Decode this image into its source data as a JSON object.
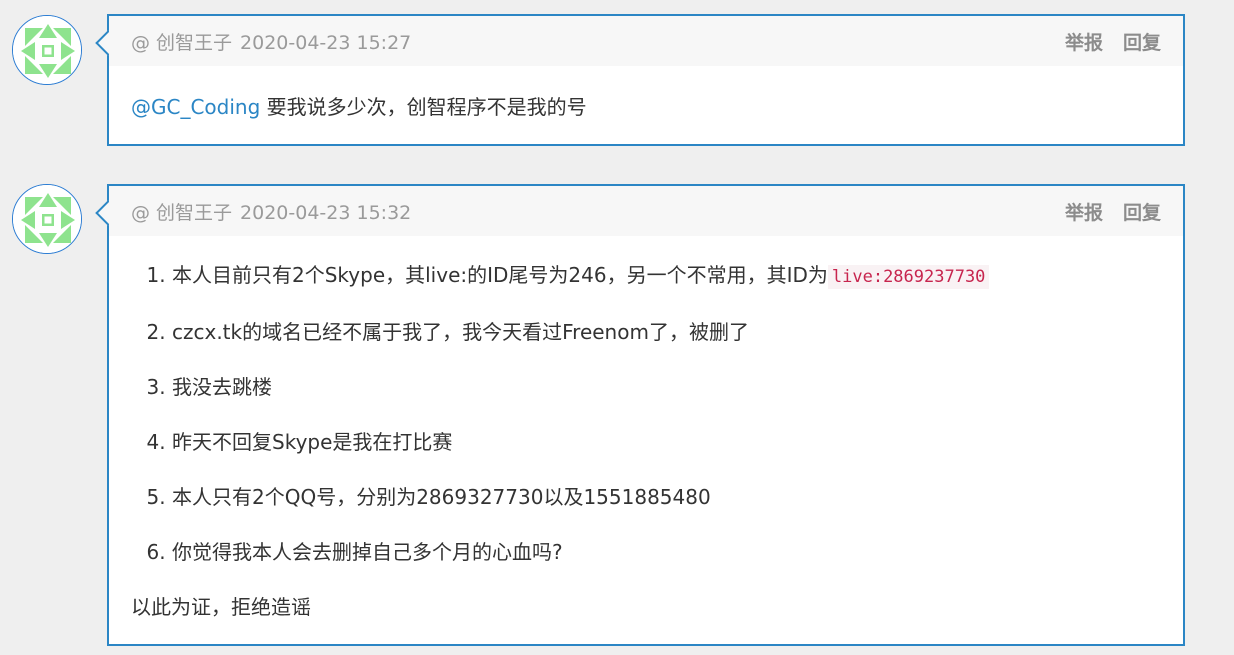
{
  "comments": [
    {
      "author": "@ 创智王子",
      "datetime": "2020-04-23 15:27",
      "report_label": "举报",
      "reply_label": "回复",
      "mention": "@GC_Coding",
      "text": "要我说多少次，创智程序不是我的号"
    },
    {
      "author": "@ 创智王子",
      "datetime": "2020-04-23 15:32",
      "report_label": "举报",
      "reply_label": "回复",
      "items": [
        {
          "text": "本人目前只有2个Skype，其live:的ID尾号为246，另一个不常用，其ID为",
          "code": "live:2869237730"
        },
        {
          "text": "czcx.tk的域名已经不属于我了，我今天看过Freenom了，被删了"
        },
        {
          "text": "我没去跳楼"
        },
        {
          "text": "昨天不回复Skype是我在打比赛"
        },
        {
          "text": "本人只有2个QQ号，分别为2869327730以及1551885480"
        },
        {
          "text": "你觉得我本人会去删掉自己多个月的心血吗?"
        }
      ],
      "footer_text": "以此为证，拒绝造谣"
    }
  ],
  "avatar_icon": "identicon-avatar-icon",
  "colors": {
    "accent": "#2b86c5",
    "code": "#c7254e",
    "avatar_fill": "#8ee38e"
  }
}
